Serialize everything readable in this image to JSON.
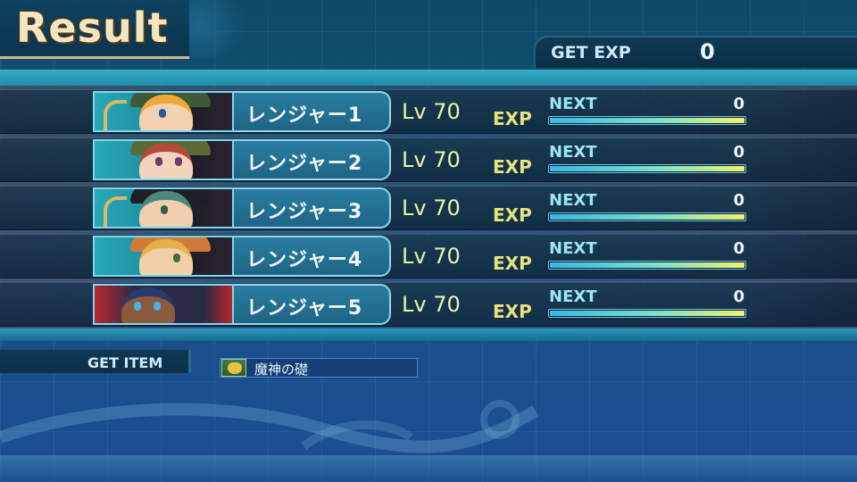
{
  "title": "Result",
  "get_exp": {
    "label": "GET EXP",
    "value": "0"
  },
  "party": [
    {
      "name": "レンジャー1",
      "level": "Lv 70",
      "exp_label": "EXP",
      "next_label": "NEXT",
      "next_value": "0",
      "progress": 1.0,
      "portrait": "ranger-1-portrait"
    },
    {
      "name": "レンジャー2",
      "level": "Lv 70",
      "exp_label": "EXP",
      "next_label": "NEXT",
      "next_value": "0",
      "progress": 1.0,
      "portrait": "ranger-2-portrait"
    },
    {
      "name": "レンジャー3",
      "level": "Lv 70",
      "exp_label": "EXP",
      "next_label": "NEXT",
      "next_value": "0",
      "progress": 1.0,
      "portrait": "ranger-3-portrait"
    },
    {
      "name": "レンジャー4",
      "level": "Lv 70",
      "exp_label": "EXP",
      "next_label": "NEXT",
      "next_value": "0",
      "progress": 1.0,
      "portrait": "ranger-4-portrait"
    },
    {
      "name": "レンジャー5",
      "level": "Lv 70",
      "exp_label": "EXP",
      "next_label": "NEXT",
      "next_value": "0",
      "progress": 1.0,
      "portrait": "ranger-5-portrait"
    }
  ],
  "get_item": {
    "label": "GET ITEM",
    "items": [
      {
        "name": "魔神の礎",
        "icon": "money-bag-icon"
      }
    ]
  },
  "colors": {
    "title_text": "#f4e6c2",
    "exp_label": "#e9e27a",
    "level_text": "#e8f4a8",
    "bar_start": "#36b8e8",
    "bar_end": "#f2f06a"
  }
}
